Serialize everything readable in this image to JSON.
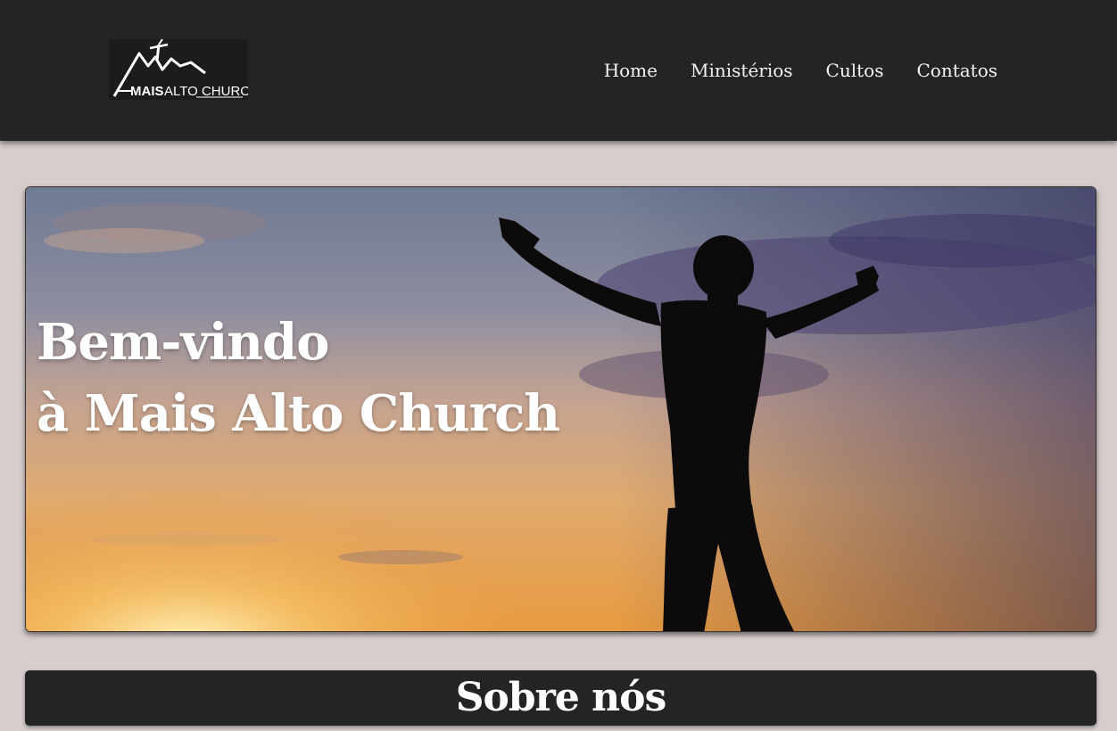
{
  "header": {
    "logo": {
      "icon": "mountain-logo-icon",
      "text_bold": "MAIS",
      "text_regular": "ALTO CHURCH"
    },
    "nav": [
      {
        "label": "Home"
      },
      {
        "label": "Ministérios"
      },
      {
        "label": "Cultos"
      },
      {
        "label": "Contatos"
      }
    ]
  },
  "hero": {
    "image": "silhouette-raised-arms-sunset",
    "title_line1": "Bem-vindo",
    "title_line2": "à Mais Alto Church"
  },
  "about": {
    "title": "Sobre nós"
  },
  "colors": {
    "header_bg": "#242424",
    "page_bg": "#d6cdcc",
    "text_light": "#ffffff"
  }
}
